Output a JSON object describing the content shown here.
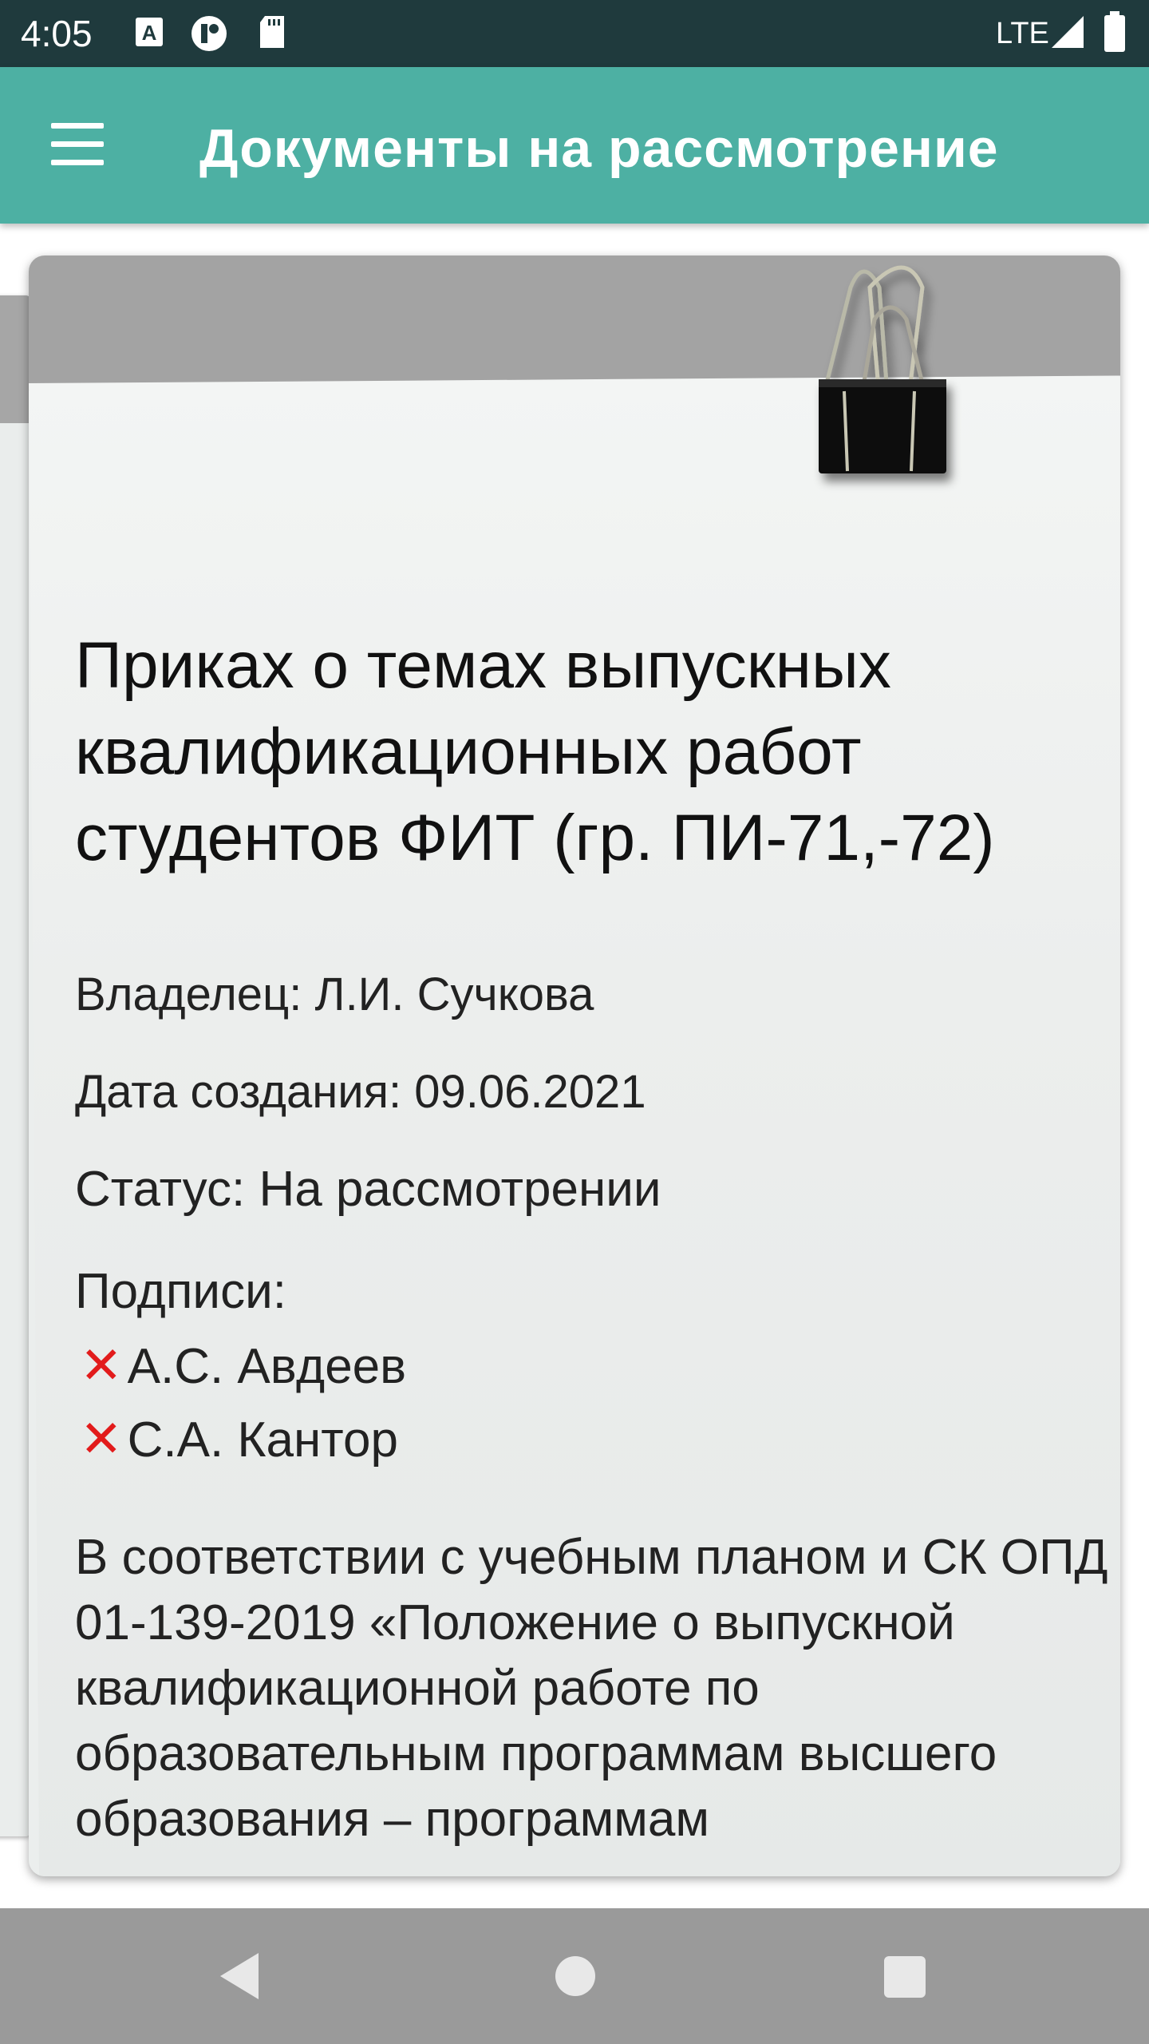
{
  "status_bar": {
    "time": "4:05",
    "network": "LTE",
    "icons": [
      "text-a-icon",
      "circle-app-icon",
      "sd-card-icon",
      "signal-icon",
      "battery-icon"
    ]
  },
  "app_bar": {
    "title": "Документы на рассмотрение",
    "menu_icon": "hamburger-menu-icon"
  },
  "document": {
    "title": "Приках о темах выпускных квалификационных работ студентов ФИТ (гр. ПИ-71,-72)",
    "owner": "Владелец: Л.И. Сучкова",
    "created": "Дата создания: 09.06.2021",
    "status": "Статус: На рассмотрении",
    "signatures_label": "Подписи:",
    "signatures": [
      {
        "mark": "✕",
        "name": "А.С. Авдеев"
      },
      {
        "mark": "✕",
        "name": "С.А. Кантор"
      }
    ],
    "body": "В соответствии с учебным планом и СК ОПД 01-139-2019 «Положение о выпускной квалификационной работе по образовательным программам высшего образования – программам"
  },
  "colors": {
    "status_bar": "#1f3a3d",
    "app_bar": "#4db0a3",
    "unsigned_mark": "#e21b1b",
    "nav_bar": "#9a9a9a"
  }
}
